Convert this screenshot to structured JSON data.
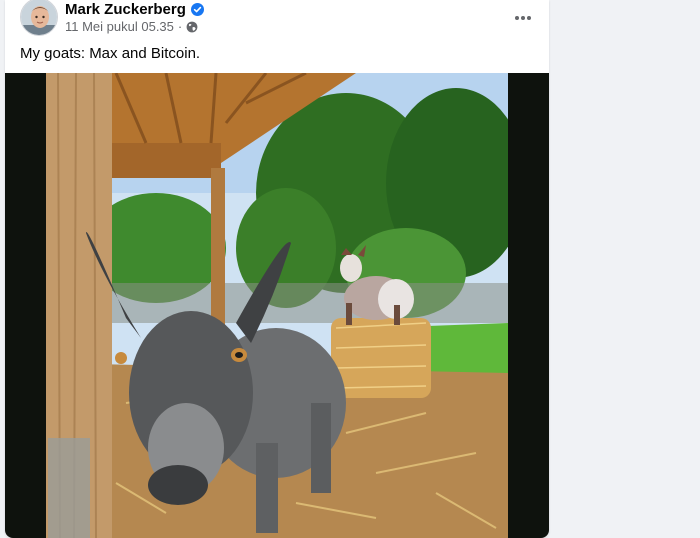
{
  "post": {
    "author": "Mark Zuckerberg",
    "timestamp": "11 Mei pukul 05.35",
    "separator": "·",
    "caption": "My goats: Max and Bitcoin.",
    "icons": {
      "verified": "verified-badge-icon",
      "audience": "globe-icon",
      "more": "more-options-icon"
    },
    "colors": {
      "verified": "#1877f2",
      "meta": "#65676b"
    }
  }
}
